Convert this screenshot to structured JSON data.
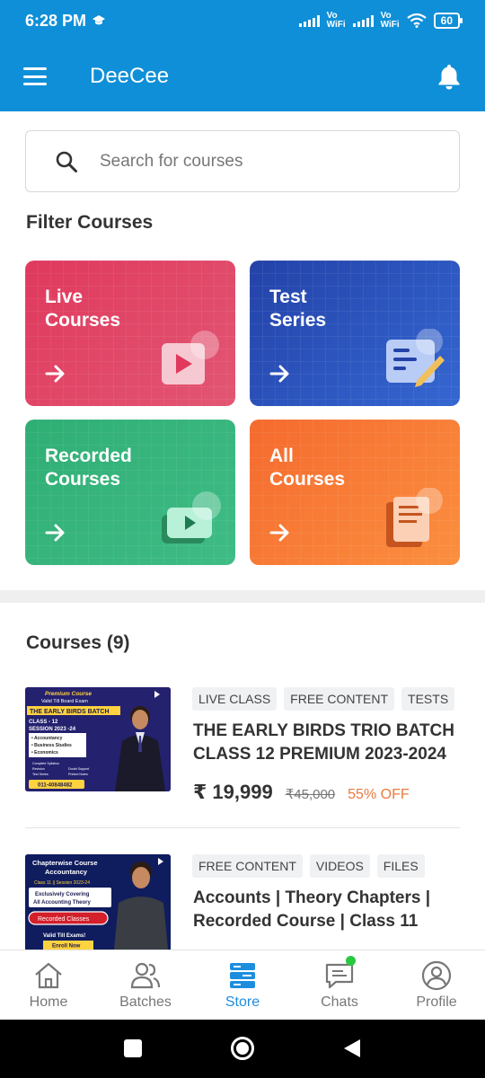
{
  "status_bar": {
    "time": "6:28 PM",
    "network_1": "Vo\nWiFi",
    "network_2": "Vo\nWiFi",
    "battery": "60"
  },
  "app_bar": {
    "title": "DeeCee"
  },
  "search": {
    "placeholder": "Search for courses"
  },
  "filter": {
    "title": "Filter Courses",
    "cards": [
      {
        "label": "Live\nCourses"
      },
      {
        "label": "Test\nSeries"
      },
      {
        "label": "Recorded\nCourses"
      },
      {
        "label": "All\nCourses"
      }
    ]
  },
  "courses": {
    "title": "Courses (9)",
    "items": [
      {
        "tags": [
          "LIVE CLASS",
          "FREE CONTENT",
          "TESTS"
        ],
        "title": "THE EARLY BIRDS TRIO BATCH CLASS 12 PREMIUM 2023-2024",
        "price": "₹ 19,999",
        "mrp": "₹45,000",
        "discount": "55% OFF",
        "thumb": {
          "line1": "Premium Course",
          "line2": "Valid Till Board Exam",
          "banner": "THE EARLY BIRDS BATCH",
          "class": "CLASS - 12",
          "session": "SESSION 2023 -24",
          "subjects": [
            "• Accountancy",
            "• Business Studies",
            "• Economics"
          ],
          "features": [
            "Complete Syllabus",
            "Doubt Support",
            "Revision",
            "Printed Notes",
            "Test Series"
          ],
          "phone": "011-40848482"
        }
      },
      {
        "tags": [
          "FREE CONTENT",
          "VIDEOS",
          "FILES"
        ],
        "title": "Accounts | Theory Chapters | Recorded Course | Class 11",
        "thumb": {
          "line1": "Chapterwise Course",
          "line2": "Accountancy",
          "line3": "Class 11 || Session 2023-24",
          "line4": "Exclusively Covering",
          "line5": "All Accounting Theory",
          "button": "Recorded Classes",
          "valid": "Valid Till Exams!",
          "enroll": "Enroll Now"
        }
      }
    ]
  },
  "bottom_nav": {
    "items": [
      {
        "label": "Home"
      },
      {
        "label": "Batches"
      },
      {
        "label": "Store"
      },
      {
        "label": "Chats"
      },
      {
        "label": "Profile"
      }
    ],
    "active": "Store"
  },
  "colors": {
    "primary": "#0f8fd8",
    "live": "#e0395d",
    "test": "#2342a8",
    "recorded": "#2fae74",
    "all": "#f56a2e",
    "discount": "#e8793f",
    "active_nav": "#1d8ede"
  }
}
